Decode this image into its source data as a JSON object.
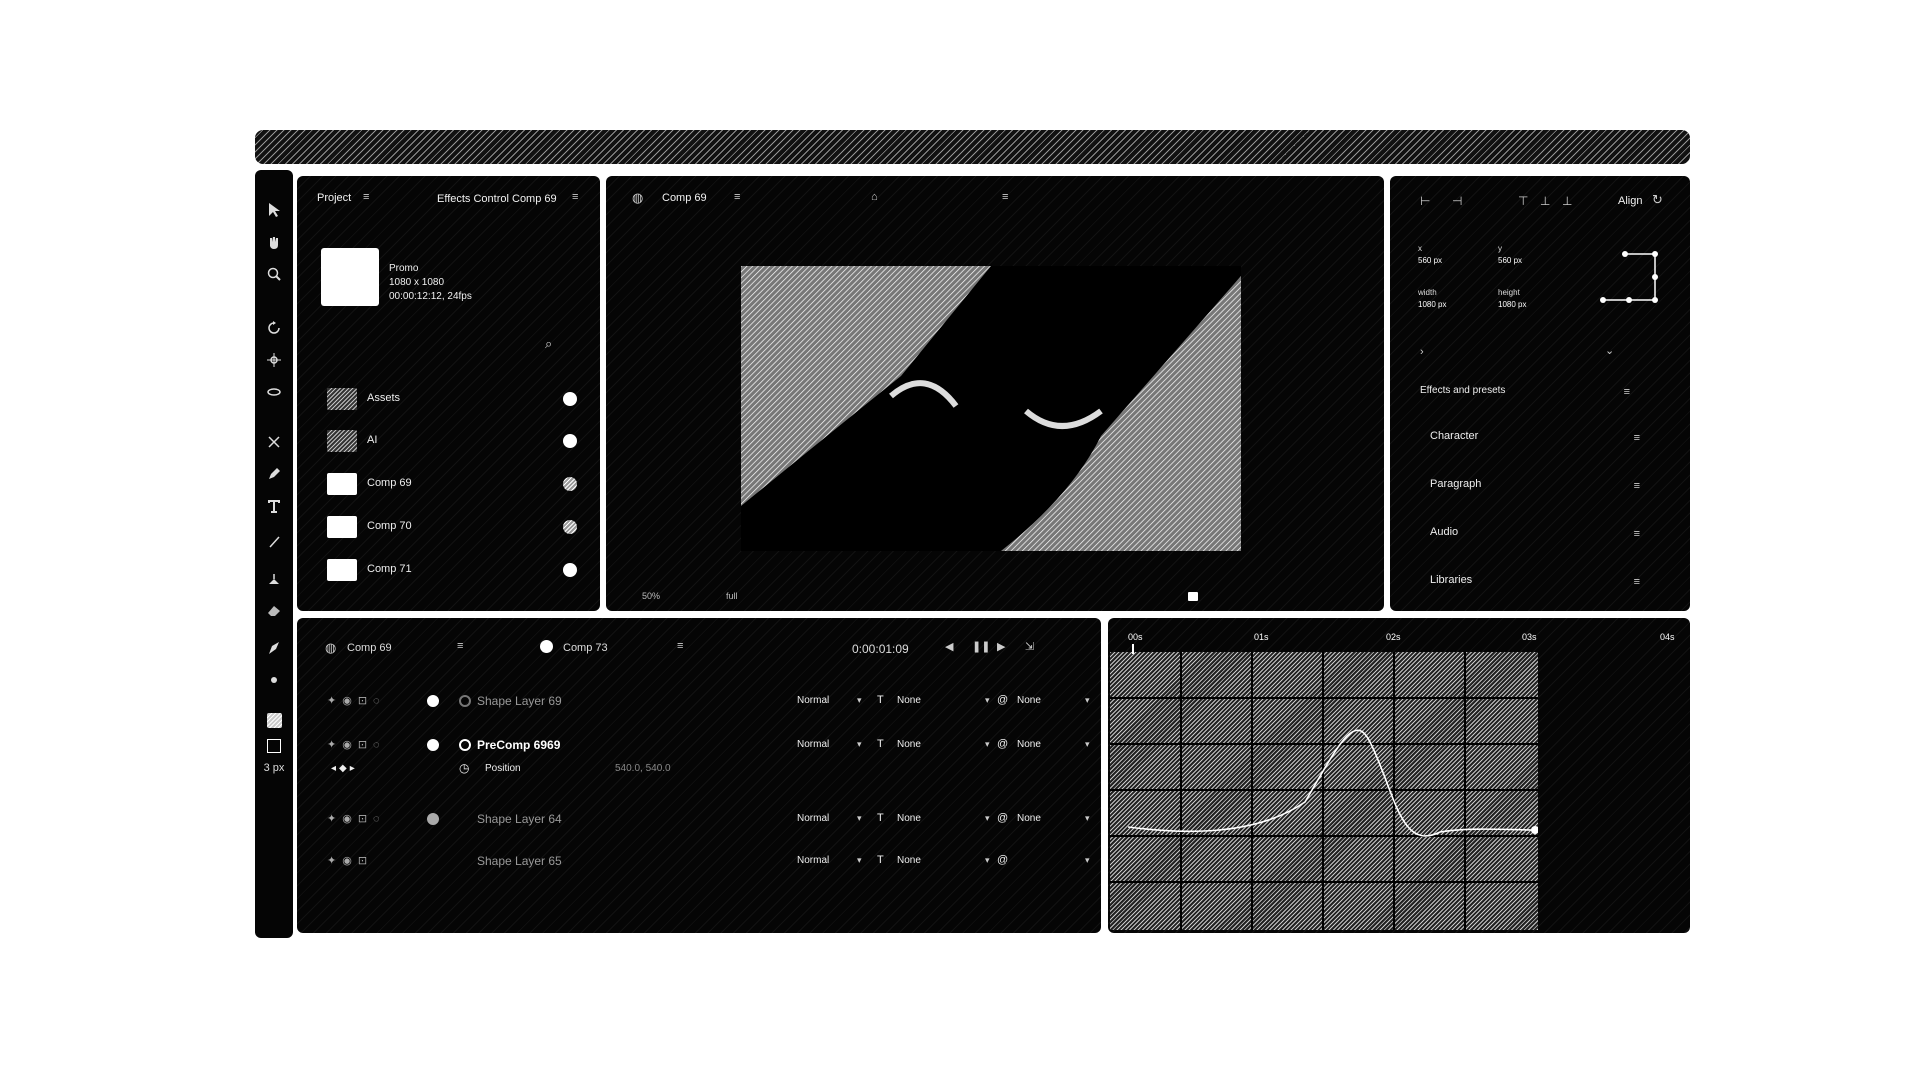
{
  "titlebar": {},
  "tools": {
    "icons": [
      "selection-icon",
      "hand-icon",
      "zoom-icon",
      "rotate-icon",
      "camera-icon",
      "orbit-icon",
      "anchor-icon",
      "pen-icon",
      "text-icon",
      "brush-icon",
      "clone-icon",
      "eraser-icon",
      "roto-icon",
      "puppet-icon",
      "fill-color-icon",
      "stroke-color-icon"
    ],
    "stroke_width": "3 px"
  },
  "project": {
    "tab_project": "Project",
    "tab_effects": "Effects Control Comp 69",
    "comp_name": "Promo",
    "comp_size": "1080 x 1080",
    "comp_duration": "00:00:12:12, 24fps",
    "items": [
      {
        "label": "Assets",
        "type": "folder"
      },
      {
        "label": "AI",
        "type": "folder"
      },
      {
        "label": "Comp 69",
        "type": "comp"
      },
      {
        "label": "Comp 70",
        "type": "comp"
      },
      {
        "label": "Comp 71",
        "type": "comp"
      }
    ]
  },
  "viewer": {
    "tab_label": "Comp 69",
    "zoom": "50%",
    "resolution": "full",
    "foot_label_1": "",
    "foot_label_2": ""
  },
  "props": {
    "align_label": "Align",
    "x_label": "x",
    "x_value": "560 px",
    "y_label": "y",
    "y_value": "560 px",
    "width_label": "width",
    "width_value": "1080 px",
    "height_label": "height",
    "height_value": "1080 px",
    "sections": [
      "Effects and presets",
      "Character",
      "Paragraph",
      "Audio",
      "Libraries"
    ]
  },
  "timeline": {
    "tab_1": "Comp 69",
    "tab_2": "Comp 73",
    "timecode": "0:00:01:09",
    "rows": [
      {
        "name": "Shape Layer 69",
        "mode": "Normal",
        "track": "None",
        "parent": "None",
        "active": false
      },
      {
        "name": "PreComp 6969",
        "mode": "Normal",
        "track": "None",
        "parent": "None",
        "active": true
      },
      {
        "name": "Shape Layer 64",
        "mode": "Normal",
        "track": "None",
        "parent": "None",
        "active": false
      },
      {
        "name": "Shape Layer 65",
        "mode": "Normal",
        "track": "None",
        "parent": "",
        "active": false
      }
    ],
    "sub_property": "Position",
    "sub_value": "540.0, 540.0"
  },
  "graph": {
    "ticks": [
      "00s",
      "01s",
      "02s",
      "03s",
      "04s"
    ]
  }
}
